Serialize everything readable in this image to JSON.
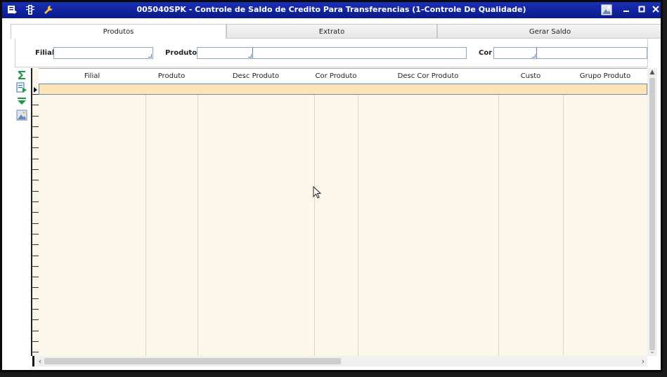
{
  "window": {
    "title": "005040SPK - Controle de Saldo de Credito Para Transferencias (1-Controle De Qualidade)",
    "titlebar_color": "#1428a8"
  },
  "tabs": [
    {
      "label": "Produtos",
      "active": true
    },
    {
      "label": "Extrato",
      "active": false
    },
    {
      "label": "Gerar Saldo",
      "active": false
    }
  ],
  "filters": {
    "filial_label": "Filial",
    "filial_value": "",
    "produto_label": "Produto",
    "produto_value": "",
    "produto_desc_value": "",
    "cor_label": "Cor",
    "cor_value": "",
    "cor_desc_value": ""
  },
  "grid": {
    "columns": [
      "Filial",
      "Produto",
      "Desc Produto",
      "Cor Produto",
      "Desc Cor Produto",
      "Custo",
      "Grupo Produto"
    ],
    "rows": [],
    "selected_row_color": "#fbe5b6",
    "background_color": "#fcf7ea"
  },
  "toolbar_icons": [
    "sum-icon",
    "export-icon",
    "filter-icon",
    "image-icon"
  ]
}
